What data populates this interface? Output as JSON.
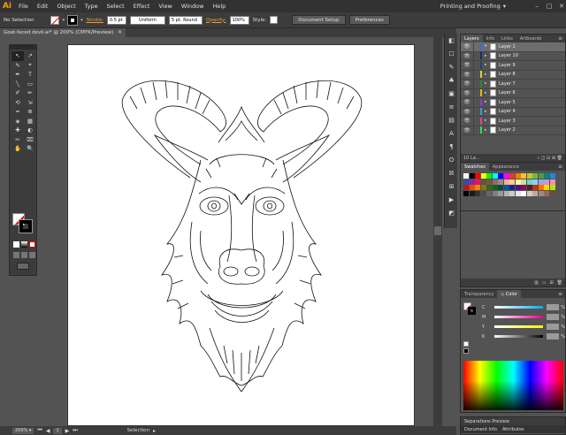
{
  "app": {
    "logo": "Ai"
  },
  "menu": [
    "File",
    "Edit",
    "Object",
    "Type",
    "Select",
    "Effect",
    "View",
    "Window",
    "Help"
  ],
  "workspace": {
    "label": "Printing and Proofing",
    "arrow": "▾"
  },
  "window_controls": [
    "–",
    "□",
    "✕"
  ],
  "control_bar": {
    "selection_label": "No Selection",
    "stroke_label": "Stroke:",
    "stroke_weight": "0.5 pt",
    "profile": "Uniform",
    "brush": "5 pt. Round",
    "opacity_label": "Opacity:",
    "opacity_value": "100%",
    "style_label": "Style:",
    "document_setup": "Document Setup",
    "preferences": "Preferences"
  },
  "document_tab": {
    "title": "Goat-faced devil.ai* @ 200% (CMYK/Preview)",
    "close": "✕"
  },
  "status_bar": {
    "zoom": "200%",
    "page": "1",
    "tool": "Selection"
  },
  "tools": [
    "↖",
    "↗",
    "✎",
    "⌖",
    "✒",
    "T",
    "╲",
    "▭",
    "✐",
    "✏",
    "⟲",
    "⇲",
    "≈",
    "⊕",
    "◈",
    "▦",
    "✚",
    "◐",
    "✂",
    "⌧",
    "✋",
    "🔍"
  ],
  "layers_panel": {
    "tabs": [
      "Layers",
      "Info",
      "Links",
      "Artboards"
    ],
    "menu": "≡",
    "layers": [
      {
        "name": "Layer 1",
        "color": "#3f6ad8",
        "expanded": true,
        "selected": true
      },
      {
        "name": "Layer 10",
        "color": "#1e2a5a",
        "expanded": false,
        "selected": false
      },
      {
        "name": "Layer 9",
        "color": "#2a3f6a",
        "expanded": false,
        "selected": false
      },
      {
        "name": "Layer 8",
        "color": "#d8d040",
        "expanded": false,
        "selected": false
      },
      {
        "name": "Layer 7",
        "color": "#2a8a3a",
        "expanded": false,
        "selected": false
      },
      {
        "name": "Layer 6",
        "color": "#d8c020",
        "expanded": false,
        "selected": false
      },
      {
        "name": "Layer 5",
        "color": "#8a3ad8",
        "expanded": false,
        "selected": false
      },
      {
        "name": "Layer 4",
        "color": "#3a9ad8",
        "expanded": false,
        "selected": false
      },
      {
        "name": "Layer 3",
        "color": "#d84a8a",
        "expanded": false,
        "selected": false
      },
      {
        "name": "Layer 2",
        "color": "#3ad84a",
        "expanded": false,
        "selected": false
      }
    ],
    "footer_count": "10 La..."
  },
  "swatches_panel": {
    "tabs": [
      "Swatches",
      "Appearance"
    ],
    "colors": [
      "#ffffff",
      "#000000",
      "#ff0000",
      "#ffff00",
      "#00ff00",
      "#00ffff",
      "#0000ff",
      "#ff00ff",
      "#e53935",
      "#f57c00",
      "#fbc02d",
      "#c0ca33",
      "#7cb342",
      "#43a047",
      "#00897b",
      "#1e88e5",
      "#3949ab",
      "#8e24aa",
      "#d81b60",
      "#6d4c41",
      "#795548",
      "#8d6e63",
      "#a1887f",
      "#ffab91",
      "#ffcc80",
      "#fff59d",
      "#c5e1a5",
      "#80cbc4",
      "#81d4fa",
      "#9fa8da",
      "#ce93d8",
      "#f48fb1",
      "#b71c1c",
      "#e65100",
      "#f57f17",
      "#827717",
      "#33691e",
      "#1b5e20",
      "#004d40",
      "#01579b",
      "#1a237e",
      "#4a148c",
      "#880e4f",
      "#3e2723",
      "#bf360c",
      "#ff6f00",
      "#ffd600",
      "#aeea00",
      "#000000",
      "#1a1a1a",
      "#333333",
      "#4d4d4d",
      "#666666",
      "#808080",
      "#999999",
      "#b3b3b3",
      "#cccccc",
      "#e6e6e6",
      "#ffffff",
      "#d7ccc8",
      "#bcaaa4",
      "#a1887f",
      "#8d6e63",
      "#6d4c41"
    ]
  },
  "bottom_tabs": {
    "transparency": "Transparency",
    "color": "Color"
  },
  "color_panel": {
    "channels": [
      "C",
      "M",
      "Y",
      "K"
    ],
    "unit": "%"
  },
  "separations": {
    "label": "Separations Preview"
  },
  "doc_tabs": [
    "Document Info",
    "Attributes"
  ]
}
